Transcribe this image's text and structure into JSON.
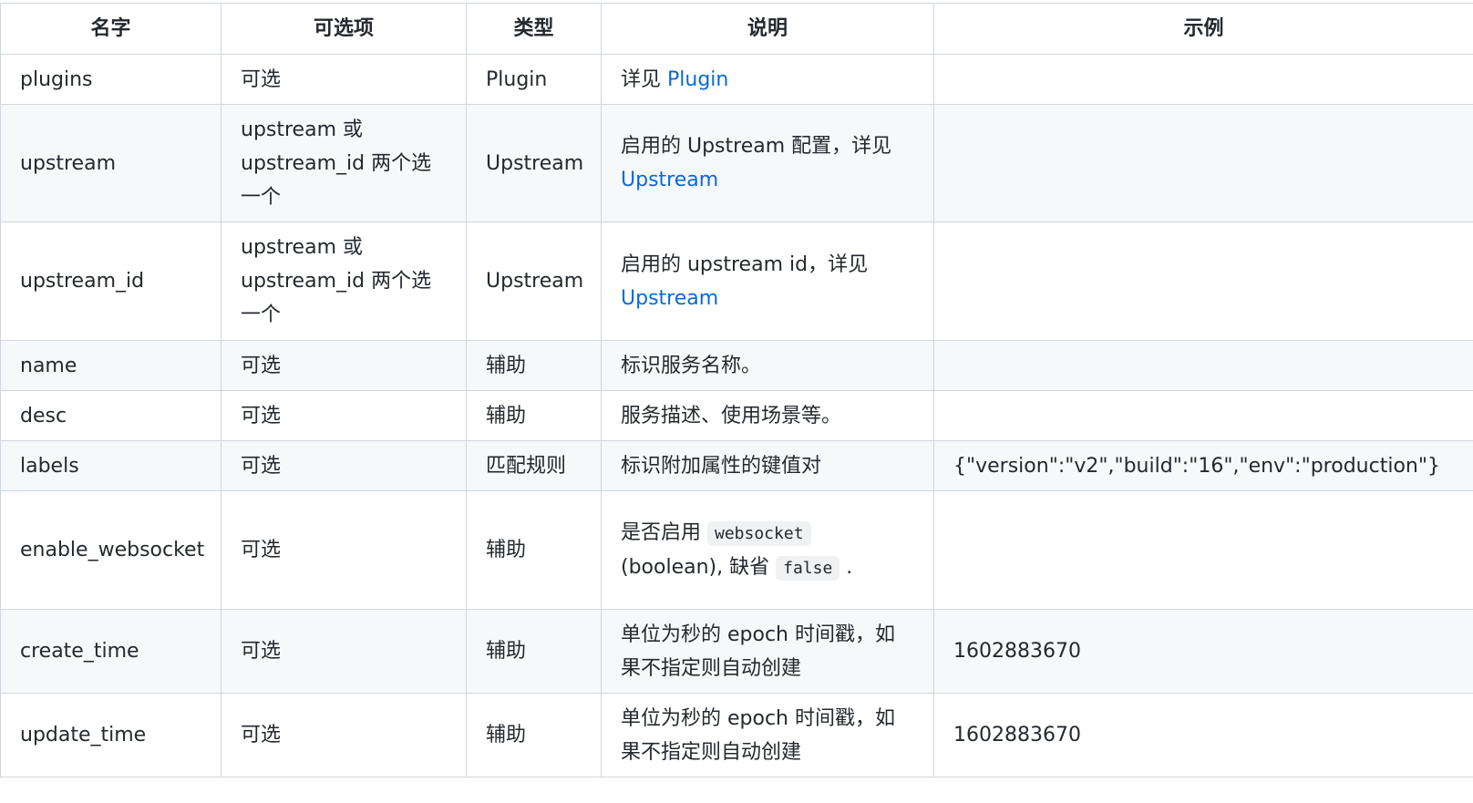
{
  "headers": [
    "名字",
    "可选项",
    "类型",
    "说明",
    "示例"
  ],
  "rows": [
    {
      "name": "plugins",
      "optional": "可选",
      "type": "Plugin",
      "desc_prefix": "详见 ",
      "desc_link": "Plugin",
      "example": ""
    },
    {
      "name": "upstream",
      "optional": "upstream 或 upstream_id 两个选一个",
      "type": "Upstream",
      "desc_prefix": "启用的 Upstream 配置，详见 ",
      "desc_link": "Upstream",
      "example": ""
    },
    {
      "name": "upstream_id",
      "optional": "upstream 或 upstream_id 两个选一个",
      "type": "Upstream",
      "desc_prefix": "启用的 upstream id，详见 ",
      "desc_link": "Upstream",
      "example": ""
    },
    {
      "name": "name",
      "optional": "可选",
      "type": "辅助",
      "desc": "标识服务名称。",
      "example": ""
    },
    {
      "name": "desc",
      "optional": "可选",
      "type": "辅助",
      "desc": "服务描述、使用场景等。",
      "example": ""
    },
    {
      "name": "labels",
      "optional": "可选",
      "type": "匹配规则",
      "desc": "标识附加属性的键值对",
      "example": "{\"version\":\"v2\",\"build\":\"16\",\"env\":\"production\"}"
    },
    {
      "name": "enable_websocket",
      "optional": "可选",
      "type": "辅助",
      "desc_part1": "是否启用 ",
      "desc_code1": "websocket",
      "desc_part2": " (boolean), 缺省 ",
      "desc_code2": "false",
      "desc_part3": " .",
      "example": ""
    },
    {
      "name": "create_time",
      "optional": "可选",
      "type": "辅助",
      "desc": "单位为秒的 epoch 时间戳，如果不指定则自动创建",
      "example": "1602883670"
    },
    {
      "name": "update_time",
      "optional": "可选",
      "type": "辅助",
      "desc": "单位为秒的 epoch 时间戳，如果不指定则自动创建",
      "example": "1602883670"
    }
  ]
}
